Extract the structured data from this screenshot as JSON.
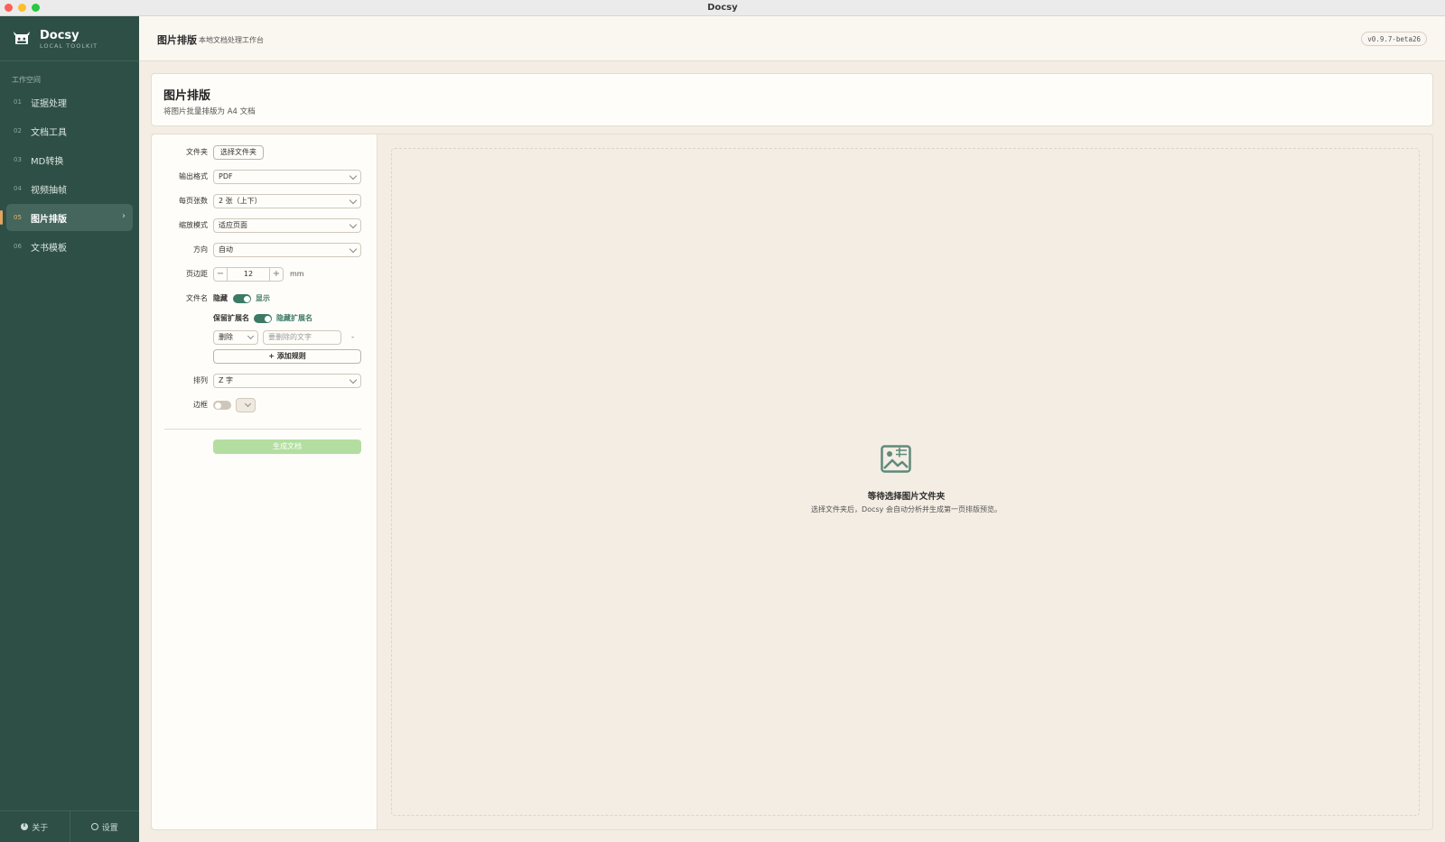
{
  "window": {
    "title": "Docsy"
  },
  "brand": {
    "name": "Docsy",
    "subtitle": "LOCAL TOOLKIT"
  },
  "sidebar": {
    "section_label": "工作空间",
    "items": [
      {
        "num": "01",
        "label": "证据处理"
      },
      {
        "num": "02",
        "label": "文档工具"
      },
      {
        "num": "03",
        "label": "MD转换"
      },
      {
        "num": "04",
        "label": "视频抽帧"
      },
      {
        "num": "05",
        "label": "图片排版",
        "active": true
      },
      {
        "num": "06",
        "label": "文书模板"
      }
    ],
    "footer": {
      "about": "关于",
      "settings": "设置"
    }
  },
  "header": {
    "title": "图片排版",
    "subtitle": "本地文档处理工作台",
    "version": "v0.9.7-beta26"
  },
  "page": {
    "title": "图片排版",
    "description": "将图片批量排版为 A4 文档"
  },
  "form": {
    "folder": {
      "label": "文件夹",
      "button": "选择文件夹"
    },
    "output_format": {
      "label": "输出格式",
      "value": "PDF"
    },
    "per_page": {
      "label": "每页张数",
      "value": "2 张（上下）"
    },
    "scale_mode": {
      "label": "缩放模式",
      "value": "适应页面"
    },
    "orientation": {
      "label": "方向",
      "value": "自动"
    },
    "margin": {
      "label": "页边距",
      "value": "12",
      "unit": "mm",
      "minus": "−",
      "plus": "+"
    },
    "filename": {
      "label": "文件名",
      "off_label": "隐藏",
      "on_label": "显示",
      "enabled": true
    },
    "extension": {
      "off_label": "保留扩展名",
      "on_label": "隐藏扩展名",
      "enabled": true
    },
    "rule": {
      "action": "删除",
      "placeholder": "要删除的文字",
      "remove": "-"
    },
    "add_rule": "+ 添加规则",
    "arrange": {
      "label": "排列",
      "value": "Z 字"
    },
    "border": {
      "label": "边框",
      "enabled": false
    },
    "generate": "生成文档"
  },
  "preview": {
    "icon": "image-icon",
    "title": "等待选择图片文件夹",
    "description": "选择文件夹后，Docsy 会自动分析并生成第一页排版预览。"
  },
  "colors": {
    "sidebar": "#2e4f46",
    "accent": "#3d7a66",
    "active_number": "#e6b36b",
    "generate_button": "#b3dea0",
    "background": "#f3ede4"
  }
}
